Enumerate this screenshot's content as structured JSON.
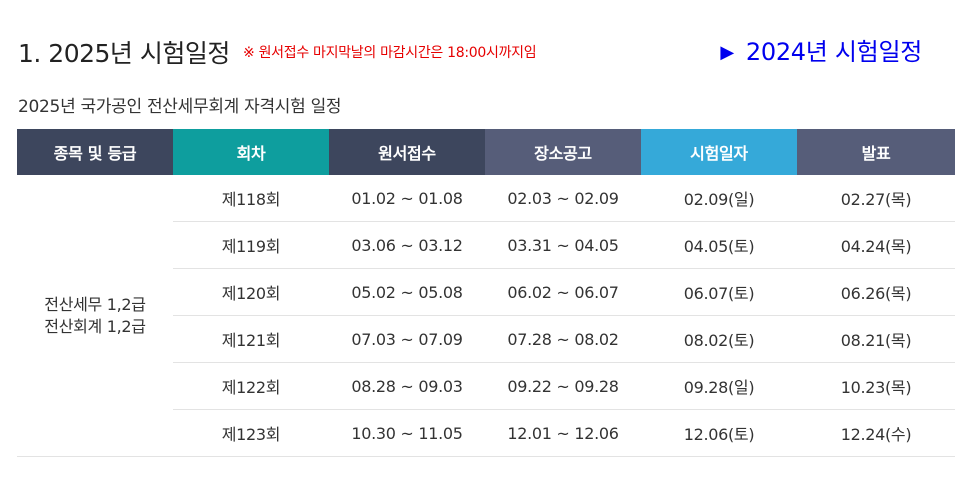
{
  "header": {
    "title": "1. 2025년 시험일정",
    "notice": "※ 원서접수 마지막날의 마감시간은 18:00시까지임",
    "prev_year_arrow": "▶",
    "prev_year_link": "2024년 시험일정"
  },
  "subtitle": "2025년 국가공인 전산세무회계 자격시험 일정",
  "table": {
    "headers": [
      "종목 및 등급",
      "회차",
      "원서접수",
      "장소공고",
      "시험일자",
      "발표"
    ],
    "category_line1": "전산세무 1,2급",
    "category_line2": "전산회계 1,2급",
    "rows": [
      {
        "round": "제118회",
        "application": "01.02 ~ 01.08",
        "venue": "02.03 ~ 02.09",
        "exam_date": "02.09(일)",
        "exam_color": "red",
        "result": "02.27(목)"
      },
      {
        "round": "제119회",
        "application": "03.06 ~ 03.12",
        "venue": "03.31 ~ 04.05",
        "exam_date": "04.05(토)",
        "exam_color": "blue",
        "result": "04.24(목)"
      },
      {
        "round": "제120회",
        "application": "05.02 ~ 05.08",
        "venue": "06.02 ~ 06.07",
        "exam_date": "06.07(토)",
        "exam_color": "blue",
        "result": "06.26(목)"
      },
      {
        "round": "제121회",
        "application": "07.03 ~ 07.09",
        "venue": "07.28 ~ 08.02",
        "exam_date": "08.02(토)",
        "exam_color": "blue",
        "result": "08.21(목)"
      },
      {
        "round": "제122회",
        "application": "08.28 ~ 09.03",
        "venue": "09.22 ~ 09.28",
        "exam_date": "09.28(일)",
        "exam_color": "red",
        "result": "10.23(목)"
      },
      {
        "round": "제123회",
        "application": "10.30 ~ 11.05",
        "venue": "12.01 ~ 12.06",
        "exam_date": "12.06(토)",
        "exam_color": "blue",
        "result": "12.24(수)"
      }
    ]
  },
  "colors": {
    "header_dark": "#3d465d",
    "header_teal": "#0e9e9e",
    "header_slate": "#565d79",
    "header_blue": "#35a9d9",
    "round_text": "#1f9d9d",
    "weekend_red": "#e60000",
    "saturday_blue": "#3a9fd6",
    "notice_red": "#e60000",
    "link_blue": "#0000ee"
  }
}
